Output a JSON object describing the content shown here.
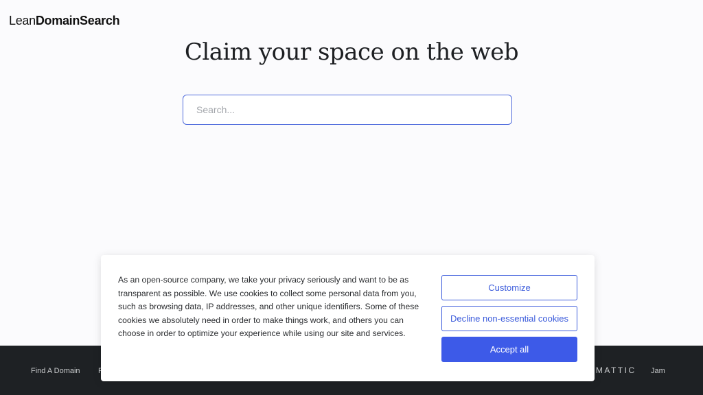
{
  "header": {
    "logo_light": "Lean",
    "logo_bold": "DomainSearch"
  },
  "hero": {
    "headline": "Claim your space on the web"
  },
  "search": {
    "placeholder": "Search...",
    "value": ""
  },
  "footer": {
    "link_find_domain": "Find A Domain",
    "link_partial": "F",
    "brand": "OMATTIC",
    "link_jam": "Jam"
  },
  "cookie_banner": {
    "text": "As an open-source company, we take your privacy seriously and want to be as transparent as possible. We use cookies to collect some personal data from you, such as browsing data, IP addresses, and other unique identifiers. Some of these cookies we absolutely need in order to make things work, and others you can choose in order to optimize your experience while using our site and services.",
    "customize_label": "Customize",
    "decline_label": "Decline non-essential cookies",
    "accept_label": "Accept all"
  },
  "colors": {
    "accent": "#3d5ae8",
    "footer_bg": "#1e2124",
    "page_bg": "#fbfbfd"
  }
}
